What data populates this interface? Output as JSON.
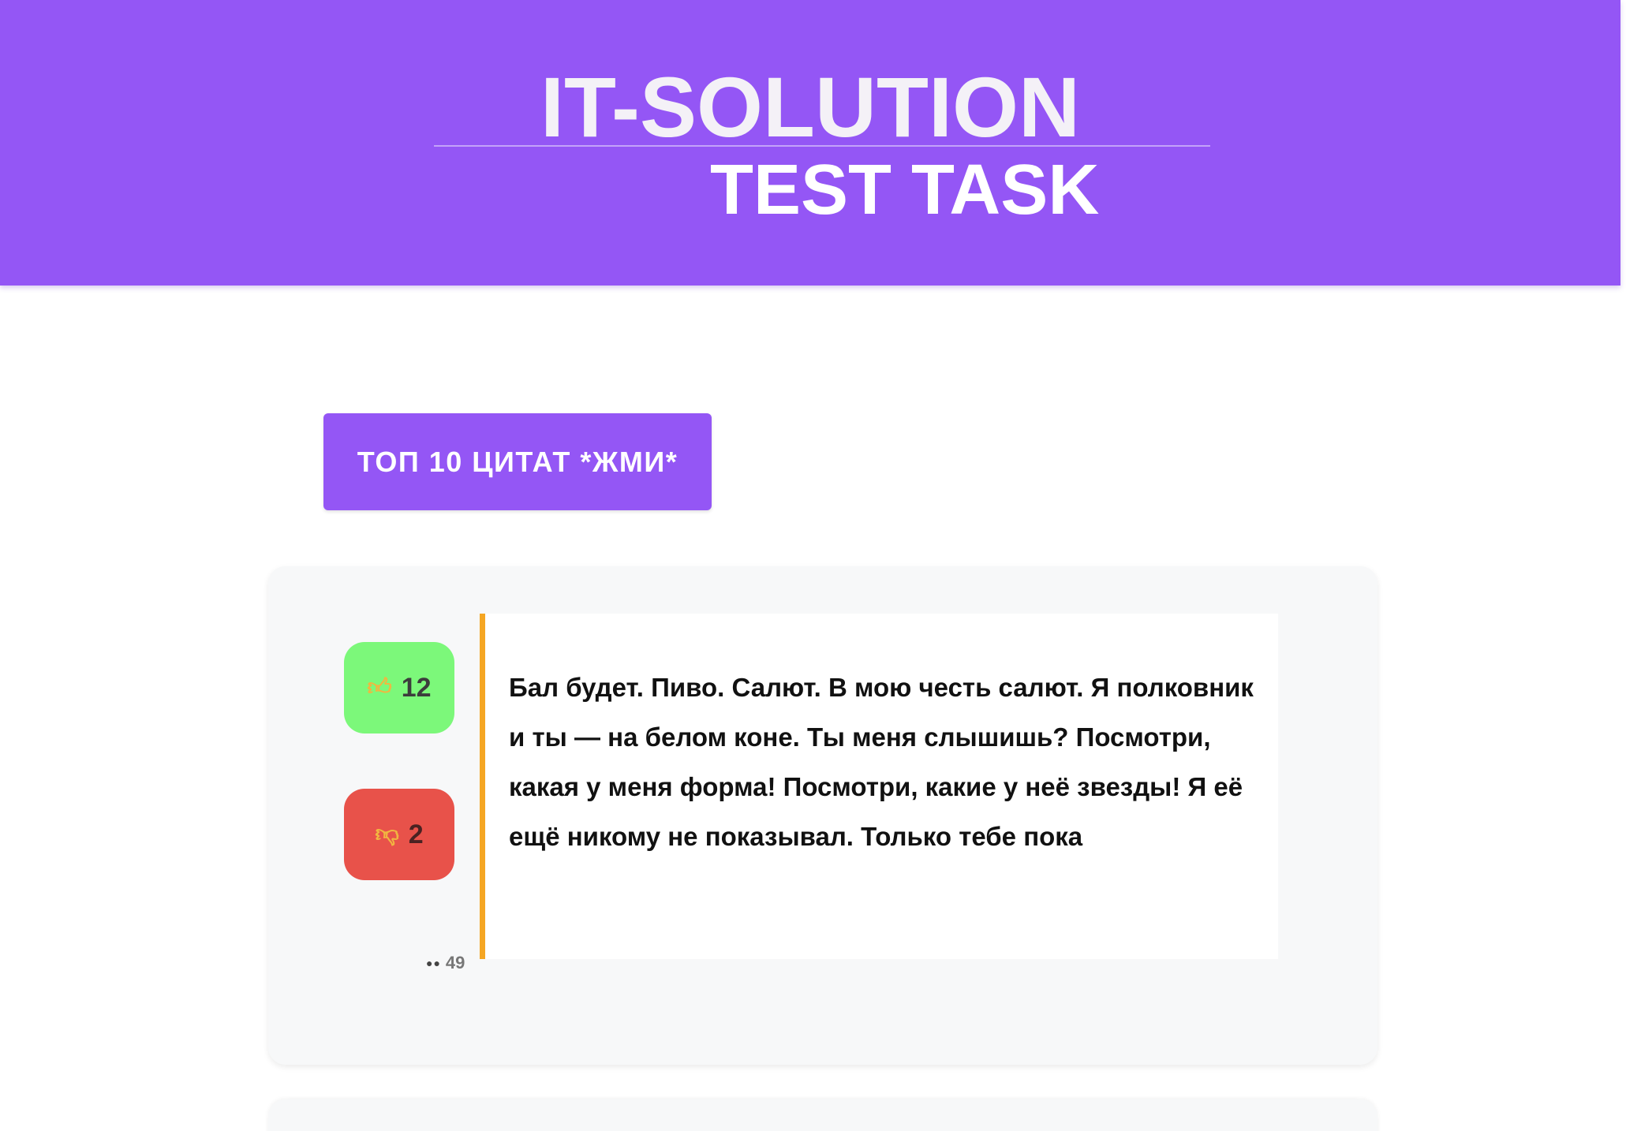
{
  "header": {
    "title": "IT-SOLUTION",
    "subtitle": "TEST TASK",
    "background_color": "#9456f5"
  },
  "top_button": {
    "label": "ТОП 10 ЦИТАТ *ЖМИ*"
  },
  "quotes": [
    {
      "likes": "12",
      "like_icon": "thumbs-up-icon",
      "dislikes": "2",
      "dislike_icon": "thumbs-down-icon",
      "views": "49",
      "views_icon": "eyes-icon",
      "text": "Бал будет. Пиво. Салют. В мою честь салют. Я полковник и ты — на белом коне. Ты меня слышишь? Посмотри, какая у меня форма! Посмотри, какие у неё звезды! Я её ещё никому не показывал. Только тебе пока",
      "accent_color": "#f5a623",
      "like_color": "#7cf87a",
      "dislike_color": "#e8524a"
    }
  ]
}
